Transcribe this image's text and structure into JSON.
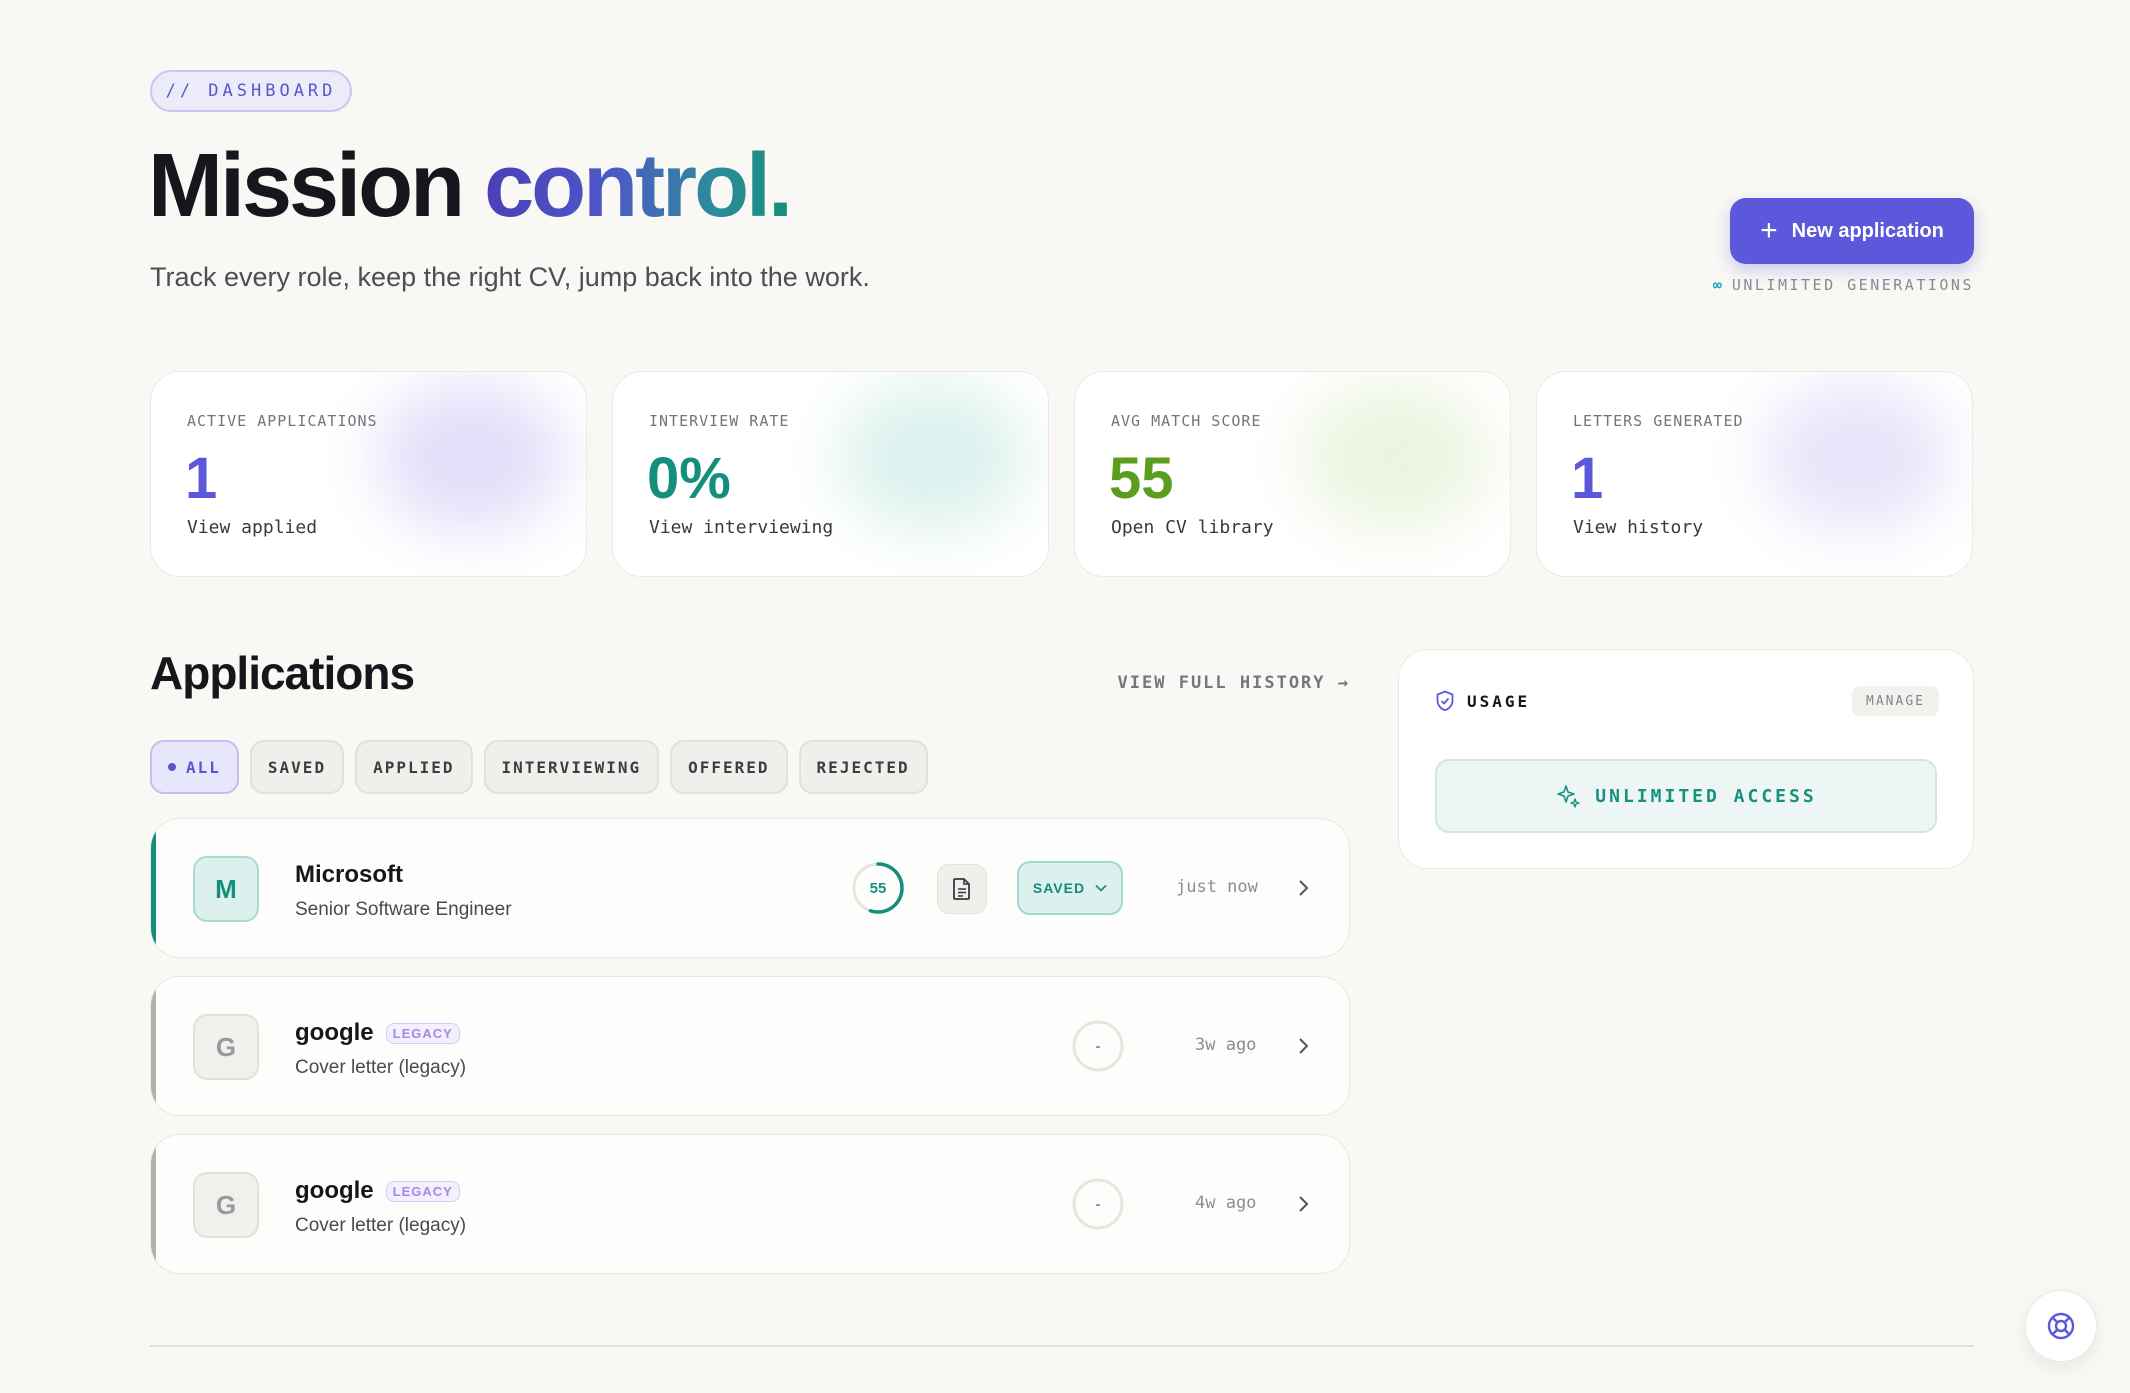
{
  "header": {
    "badge": "// DASHBOARD",
    "title_main": "Mission",
    "title_accent": "control.",
    "subtitle": "Track every role, keep the right CV, jump back into the work.",
    "new_button": "New application",
    "generations_note": "UNLIMITED GENERATIONS",
    "generations_icon": "infinity-icon"
  },
  "stats": [
    {
      "label": "ACTIVE APPLICATIONS",
      "value": "1",
      "link": "View applied",
      "color": "#5c58db"
    },
    {
      "label": "INTERVIEW RATE",
      "value": "0%",
      "link": "View interviewing",
      "color": "#148f7c"
    },
    {
      "label": "AVG MATCH SCORE",
      "value": "55",
      "link": "Open CV library",
      "color": "#5b9e1d"
    },
    {
      "label": "LETTERS GENERATED",
      "value": "1",
      "link": "View history",
      "color": "#5c58db"
    }
  ],
  "applications": {
    "heading": "Applications",
    "view_history": "VIEW FULL HISTORY →",
    "filters": [
      "ALL",
      "SAVED",
      "APPLIED",
      "INTERVIEWING",
      "OFFERED",
      "REJECTED"
    ],
    "active_filter": "ALL",
    "rows": [
      {
        "initial": "M",
        "company": "Microsoft",
        "role": "Senior Software Engineer",
        "score": "55",
        "score_fraction": 0.55,
        "status": "SAVED",
        "time": "just now",
        "legacy": ""
      },
      {
        "initial": "G",
        "company": "google",
        "role": "Cover letter (legacy)",
        "score": "-",
        "score_fraction": 0,
        "status": "",
        "time": "3w ago",
        "legacy": "LEGACY"
      },
      {
        "initial": "G",
        "company": "google",
        "role": "Cover letter (legacy)",
        "score": "-",
        "score_fraction": 0,
        "status": "",
        "time": "4w ago",
        "legacy": "LEGACY"
      }
    ]
  },
  "usage": {
    "title": "USAGE",
    "manage": "MANAGE",
    "access": "UNLIMITED ACCESS"
  },
  "colors": {
    "accent": "#5c58db",
    "teal": "#148f7c",
    "green": "#5b9e1d"
  }
}
